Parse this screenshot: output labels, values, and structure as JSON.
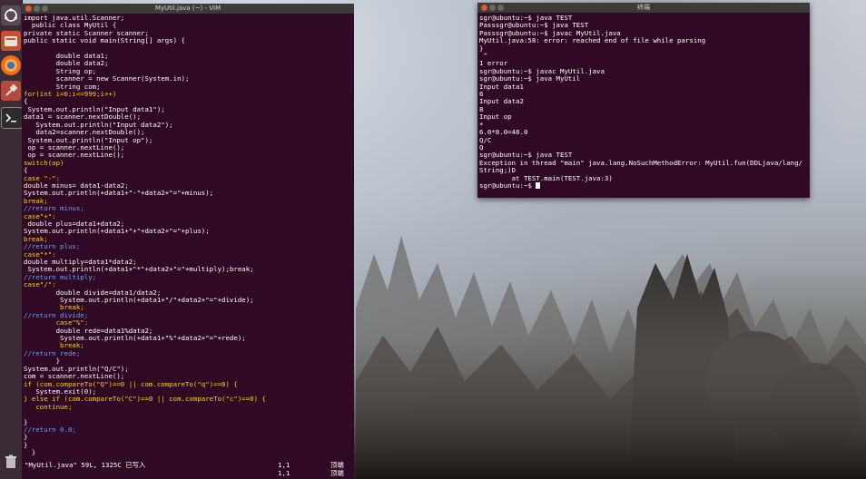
{
  "vim": {
    "title": "MyUtil.java (~) - VIM",
    "lines": [
      "import java.util.Scanner;",
      "  public class MyUtil {",
      "private static Scanner scanner;",
      "public static void main(String[] args) {",
      "",
      "        double data1;",
      "        double data2;",
      "        String op;",
      "        scanner = new Scanner(System.in);",
      "        String com;",
      "for(int i=0;i<=999;i++)",
      "{",
      " System.out.println(\"Input data1\");",
      "data1 = scanner.nextDouble();",
      "   System.out.println(\"Input data2\");",
      "   data2=scanner.nextDouble();",
      " System.out.println(\"Input op\");",
      " op = scanner.nextLine();",
      " op = scanner.nextLine();",
      "switch(op)",
      "{",
      "case \"-\":",
      "double minus= data1-data2;",
      "System.out.println(+data1+\"-\"+data2+\"=\"+minus);",
      "break;",
      "//return minus;",
      "case\"+\":",
      " double plus=data1+data2;",
      "System.out.println(+data1+\"+\"+data2+\"=\"+plus);",
      "break;",
      "//return plus;",
      "case\"*\":",
      "double multiply=data1*data2;",
      " System.out.println(+data1+\"*\"+data2+\"=\"+multiply);break;",
      "//return multiply;",
      "case\"/\":",
      "        double divide=data1/data2;",
      "         System.out.println(+data1+\"/\"+data2+\"=\"+divide);",
      "         break;",
      "//return divide;",
      "        case\"%\":",
      "        double rede=data1%data2;",
      "         System.out.println(+data1+\"%\"+data2+\"=\"+rede);",
      "         break;",
      "//return rede;",
      "        }",
      "System.out.println(\"Q/C\");",
      "com = scanner.nextLine();",
      "if (com.compareTo(\"Q\")==0 || com.compareTo(\"q\")==0) {",
      "   System.exit(0);",
      "} else if (com.compareTo(\"C\")==0 || com.compareTo(\"c\")==0) {",
      "   continue;",
      "",
      "}",
      "//return 0.0;",
      "}",
      "}",
      "  }"
    ],
    "status_file": "\"MyUtil.java\" 59L, 1325C 已写入",
    "status_pos": "1,1",
    "status_where": "顶端",
    "ruler_pos": "1,1",
    "ruler_where": "顶端"
  },
  "terminal": {
    "title": "终端",
    "lines": [
      "sgr@ubuntu:~$ java TEST",
      "Passsgr@ubuntu:~$ java TEST",
      "Passsgr@ubuntu:~$ javac MyUtil.java",
      "MyUtil.java:58: error: reached end of file while parsing",
      "}",
      " ^",
      "1 error",
      "sgr@ubuntu:~$ javac MyUtil.java",
      "sgr@ubuntu:~$ java MyUtil",
      "Input data1",
      "6",
      "Input data2",
      "8",
      "Input op",
      "*",
      "6.0*8.0=48.0",
      "Q/C",
      "Q",
      "sgr@ubuntu:~$ java TEST",
      "Exception in thread \"main\" java.lang.NoSuchMethodError: MyUtil.fun(DDLjava/lang/",
      "String;)D",
      "        at TEST.main(TEST.java:3)",
      "sgr@ubuntu:~$ "
    ]
  },
  "launcher": {
    "items": [
      "ubuntu-logo-icon",
      "files-icon",
      "firefox-icon",
      "settings-icon",
      "terminal-icon",
      "trash-icon"
    ]
  }
}
